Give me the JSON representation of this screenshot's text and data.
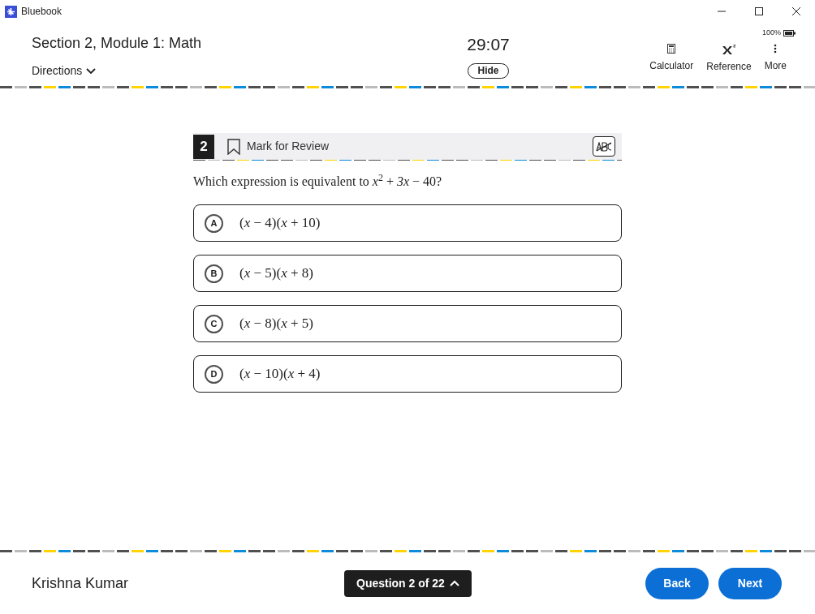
{
  "window": {
    "title": "Bluebook"
  },
  "header": {
    "section": "Section 2, Module 1: Math",
    "directions": "Directions",
    "timer": "29:07",
    "hide_button": "Hide",
    "battery": "100%",
    "tools": [
      {
        "kind": "calculator",
        "label": "Calculator"
      },
      {
        "kind": "reference",
        "label": "Reference"
      },
      {
        "kind": "more",
        "label": "More"
      }
    ]
  },
  "question": {
    "number": "2",
    "mark_for_review": "Mark for Review",
    "marked": false,
    "prompt": "Which expression is equivalent to *x*$^{2}$ + *3x* − 40?",
    "choices": [
      {
        "letter": "A",
        "text": "(*x* − 4)(*x* + 10)",
        "selected": false
      },
      {
        "letter": "B",
        "text": "(*x* − 5)(*x* + 8)",
        "selected": false
      },
      {
        "letter": "C",
        "text": "(*x* − 8)(*x* + 5)",
        "selected": false
      },
      {
        "letter": "D",
        "text": "(*x* − 10)(*x* + 4)",
        "selected": false
      }
    ]
  },
  "footer": {
    "student": "Krishna Kumar",
    "navigator": "Question 2 of 22",
    "buttons": [
      "Back",
      "Next"
    ]
  }
}
